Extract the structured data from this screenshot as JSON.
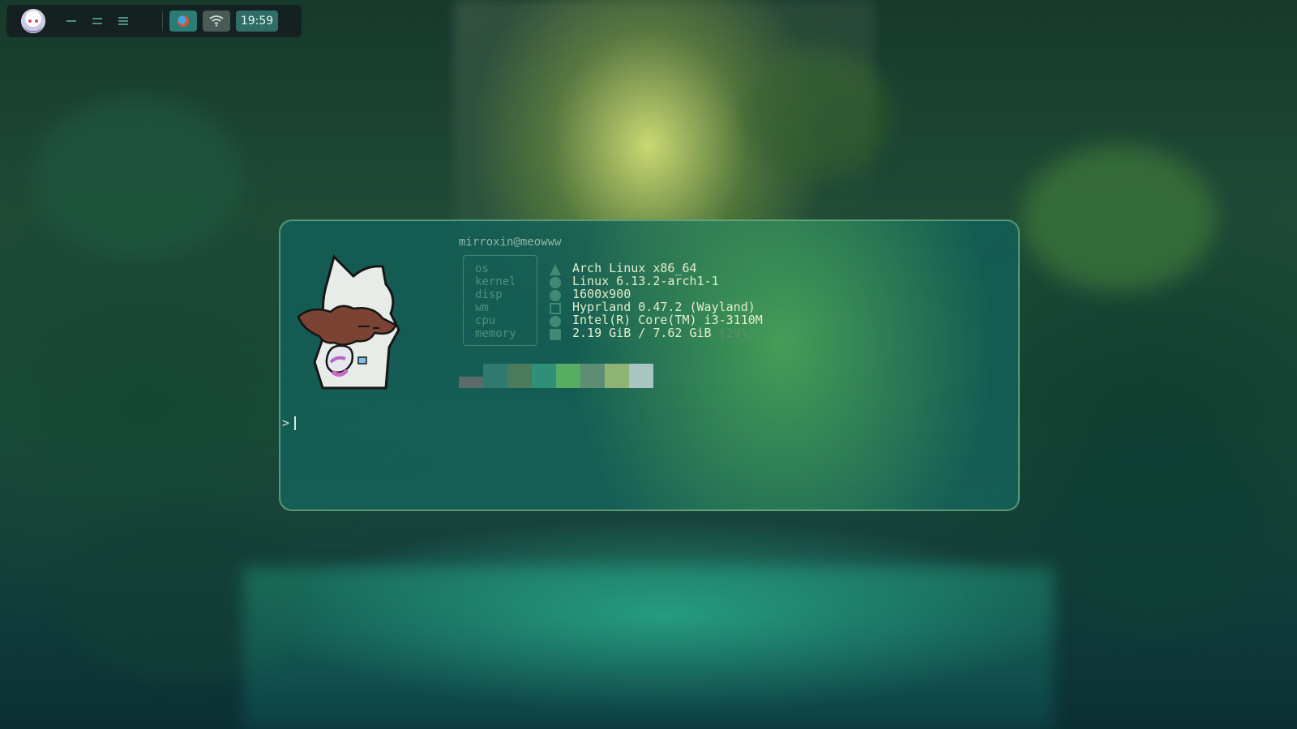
{
  "topbar": {
    "workspaces": [
      "workspace-1",
      "workspace-2",
      "workspace-3"
    ],
    "clock": "19:59",
    "icons": [
      "avatar",
      "app-icon",
      "wifi-icon"
    ]
  },
  "terminal": {
    "user_host": "mirroxin@meowww",
    "info": [
      {
        "key": "os",
        "icon": "arch-icon",
        "value": "Arch Linux x86_64"
      },
      {
        "key": "kernel",
        "icon": "gear-icon",
        "value": "Linux 6.13.2-arch1-1"
      },
      {
        "key": "disp",
        "icon": "display-icon",
        "value": "1600x900"
      },
      {
        "key": "wm",
        "icon": "window-icon",
        "value": "Hyprland 0.47.2 (Wayland)"
      },
      {
        "key": "cpu",
        "icon": "cpu-icon",
        "value": "Intel(R) Core(TM) i3-3110M"
      },
      {
        "key": "memory",
        "icon": "memory-icon",
        "value": "2.19 GiB / 7.62 GiB ",
        "extra": "(29%)"
      }
    ],
    "palette": [
      "#5a6b6a",
      "#2f7a6e",
      "#4c7a5c",
      "#2f8f78",
      "#57ad62",
      "#5d8d72",
      "#8fb373",
      "#a9c5c2"
    ],
    "prompt": ">"
  }
}
